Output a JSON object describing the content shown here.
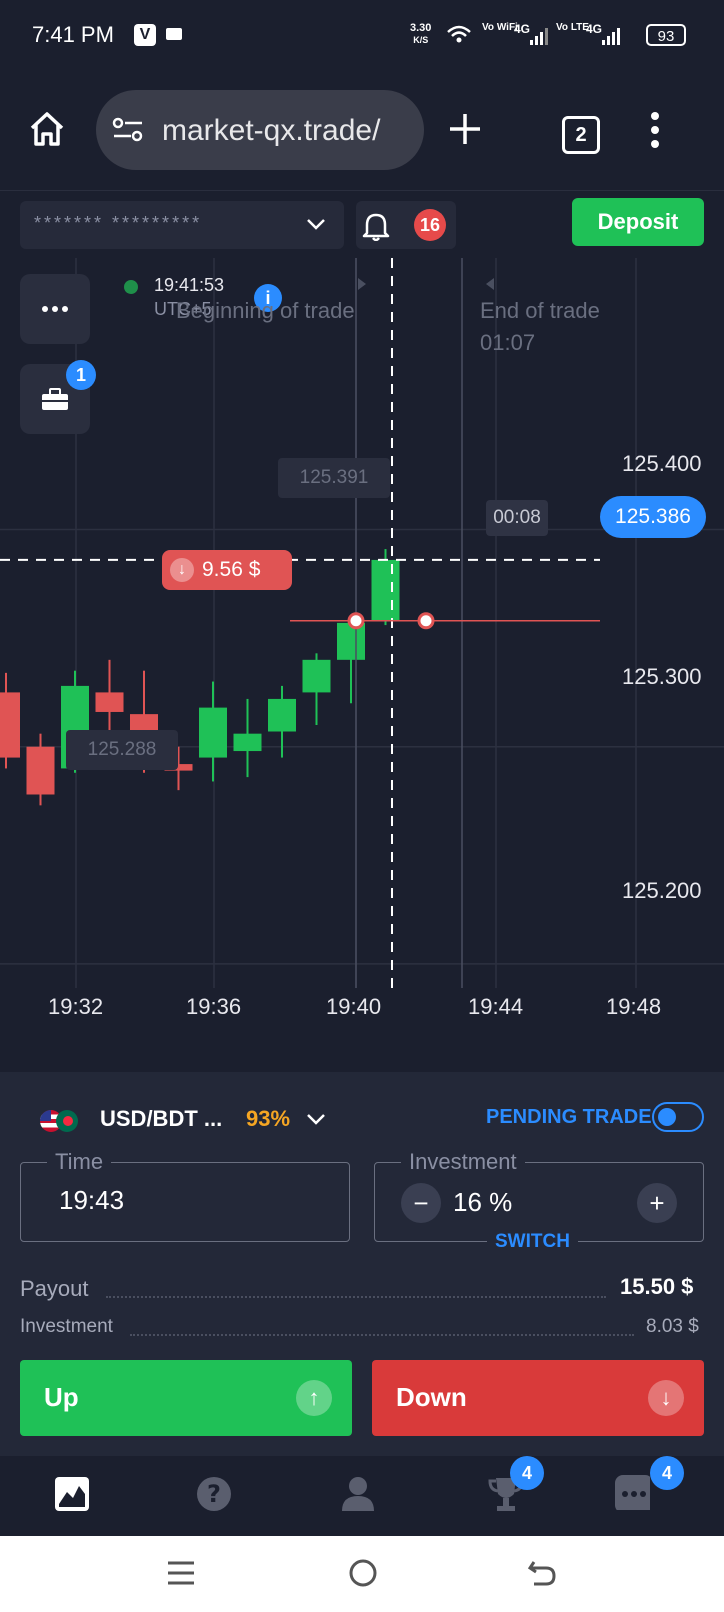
{
  "status_bar": {
    "time": "7:41 PM",
    "net_speed_value": "3.30",
    "net_speed_unit": "K/S",
    "wifi_label": "Vo WiFi",
    "sig1": "4G",
    "lte_label": "Vo LTE",
    "sig2": "4G",
    "battery": "93",
    "icons": [
      "v-app-icon",
      "video-icon",
      "wifi-icon",
      "signal-icon",
      "battery-icon"
    ]
  },
  "browser": {
    "url": "market-qx.trade/",
    "tab_count": "2",
    "icons": [
      "home-icon",
      "site-settings-icon",
      "new-tab-icon",
      "more-icon"
    ]
  },
  "topbar": {
    "account_masked": "******* *********",
    "notification_count": "16",
    "deposit_label": "Deposit"
  },
  "chart": {
    "clock_time": "19:41:53",
    "timezone": "UTC+5",
    "beginning_label": "Beginning of trade",
    "end_label": "End of trade",
    "end_countdown": "01:07",
    "briefcase_badge": "1",
    "high_marker": "125.391",
    "low_marker": "125.288",
    "current_price": "125.386",
    "current_countdown": "00:08",
    "trade_amount_label": "9.56 $",
    "price_ticks": [
      "125.400",
      "125.300",
      "125.200"
    ],
    "time_ticks": [
      "19:32",
      "19:36",
      "19:40",
      "19:44",
      "19:48"
    ],
    "colors": {
      "up": "#1fc157",
      "down": "#e05454",
      "accent": "#2b8cff"
    }
  },
  "chart_data": {
    "type": "candlestick",
    "x": [
      "c1",
      "c2",
      "c3",
      "c4",
      "c5",
      "c6",
      "c7",
      "c8",
      "c9",
      "c10",
      "c11",
      "c12"
    ],
    "open": [
      125.325,
      125.3,
      125.29,
      125.325,
      125.315,
      125.292,
      125.295,
      125.298,
      125.307,
      125.325,
      125.34,
      125.358
    ],
    "close": [
      125.295,
      125.278,
      125.328,
      125.316,
      125.292,
      125.289,
      125.318,
      125.306,
      125.322,
      125.34,
      125.357,
      125.386
    ],
    "high": [
      125.334,
      125.306,
      125.335,
      125.34,
      125.335,
      125.3,
      125.33,
      125.322,
      125.328,
      125.343,
      125.36,
      125.391
    ],
    "low": [
      125.29,
      125.273,
      125.288,
      125.305,
      125.288,
      125.28,
      125.284,
      125.286,
      125.295,
      125.31,
      125.32,
      125.356
    ],
    "ylim": [
      125.153,
      125.525
    ],
    "y_ticks": [
      125.4,
      125.3,
      125.2
    ],
    "x_ticks": [
      "19:32",
      "19:36",
      "19:40",
      "19:44",
      "19:48"
    ],
    "open_trade_price": 125.358,
    "current_price": 125.386
  },
  "panel": {
    "asset": "USD/BDT ...",
    "payout_pct": "93%",
    "pending_label": "PENDING TRADE",
    "time_legend": "Time",
    "time_value": "19:43",
    "investment_legend": "Investment",
    "investment_value": "16 %",
    "minus": "−",
    "plus": "+",
    "switch_label": "SWITCH",
    "payout_label": "Payout",
    "payout_value": "15.50 $",
    "investment_label": "Investment",
    "investment_amount": "8.03 $",
    "up_label": "Up",
    "down_label": "Down"
  },
  "bottom_nav": {
    "trophy_badge": "4",
    "chat_badge": "4",
    "icons": [
      "chart-icon",
      "help-icon",
      "profile-icon",
      "trophy-icon",
      "chat-icon"
    ]
  },
  "system_nav": {
    "icons": [
      "recents-icon",
      "home-circle-icon",
      "back-icon"
    ]
  }
}
